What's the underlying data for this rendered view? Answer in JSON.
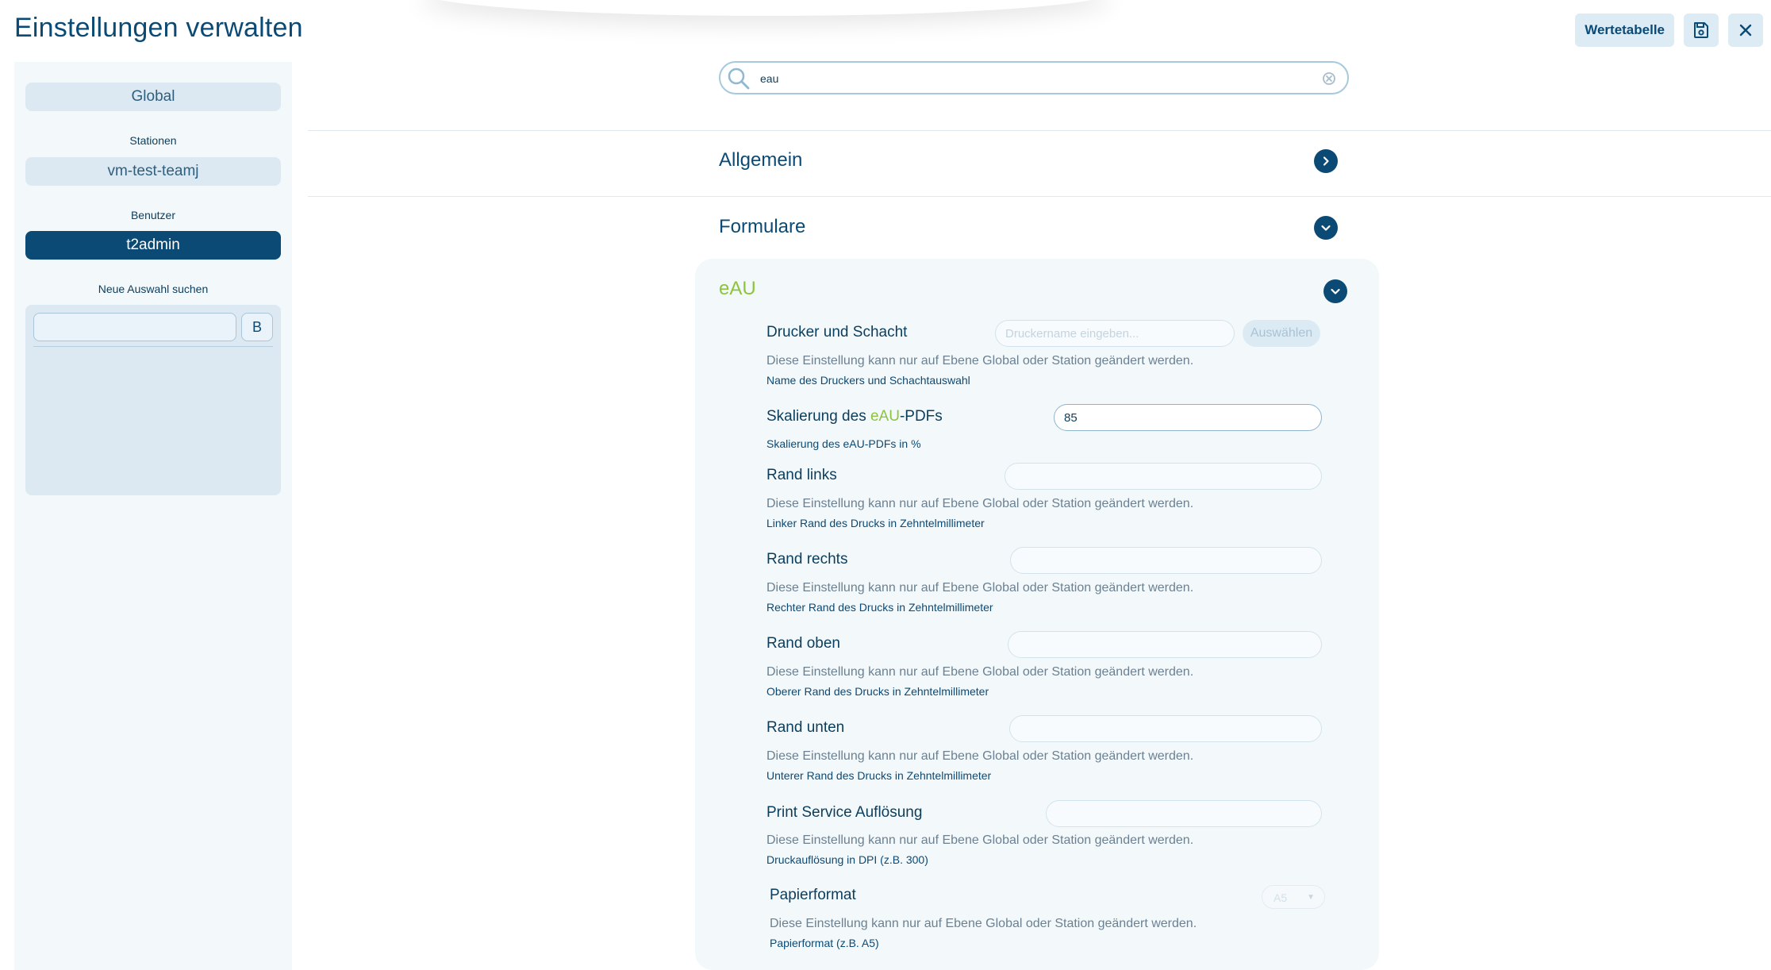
{
  "header": {
    "title": "Einstellungen verwalten",
    "wertetabelle_label": "Wertetabelle",
    "save_icon": "save-icon",
    "close_icon": "close-icon"
  },
  "sidebar": {
    "global_label": "Global",
    "stationen_label": "Stationen",
    "station_value": "vm-test-teamj",
    "benutzer_label": "Benutzer",
    "benutzer_value": "t2admin",
    "neue_auswahl_label": "Neue Auswahl suchen",
    "search_value": "",
    "b_button_label": "B"
  },
  "search": {
    "value": "eau",
    "icon": "search-icon",
    "clear_icon": "clear-icon"
  },
  "sections": [
    {
      "title": "Allgemein",
      "expanded": false
    },
    {
      "title": "Formulare",
      "expanded": true
    }
  ],
  "eau": {
    "title": "eAU",
    "accent_color": "#8cc43c",
    "settings": {
      "drucker": {
        "name": "Drucker und Schacht",
        "placeholder": "Druckername eingeben...",
        "button": "Auswählen",
        "note": "Diese Einstellung kann nur auf Ebene Global oder Station geändert werden.",
        "desc": "Name des Druckers und Schachtauswahl"
      },
      "skalierung": {
        "name_prefix": "Skalierung des ",
        "name_highlight": "eAU",
        "name_suffix": "-PDFs",
        "value": "85",
        "desc": "Skalierung des eAU-PDFs in %"
      },
      "rand_links": {
        "name": "Rand links",
        "note": "Diese Einstellung kann nur auf Ebene Global oder Station geändert werden.",
        "desc": "Linker Rand des Drucks in Zehntelmillimeter"
      },
      "rand_rechts": {
        "name": "Rand rechts",
        "note": "Diese Einstellung kann nur auf Ebene Global oder Station geändert werden.",
        "desc": "Rechter Rand des Drucks in Zehntelmillimeter"
      },
      "rand_oben": {
        "name": "Rand oben",
        "note": "Diese Einstellung kann nur auf Ebene Global oder Station geändert werden.",
        "desc": "Oberer Rand des Drucks in Zehntelmillimeter"
      },
      "rand_unten": {
        "name": "Rand unten",
        "note": "Diese Einstellung kann nur auf Ebene Global oder Station geändert werden.",
        "desc": "Unterer Rand des Drucks in Zehntelmillimeter"
      },
      "print_service": {
        "name": "Print Service Auflösung",
        "note": "Diese Einstellung kann nur auf Ebene Global oder Station geändert werden.",
        "desc": "Druckauflösung in DPI (z.B. 300)"
      },
      "papierformat": {
        "name": "Papierformat",
        "value": "A5",
        "note": "Diese Einstellung kann nur auf Ebene Global oder Station geändert werden.",
        "desc": "Papierformat (z.B. A5)"
      }
    }
  }
}
